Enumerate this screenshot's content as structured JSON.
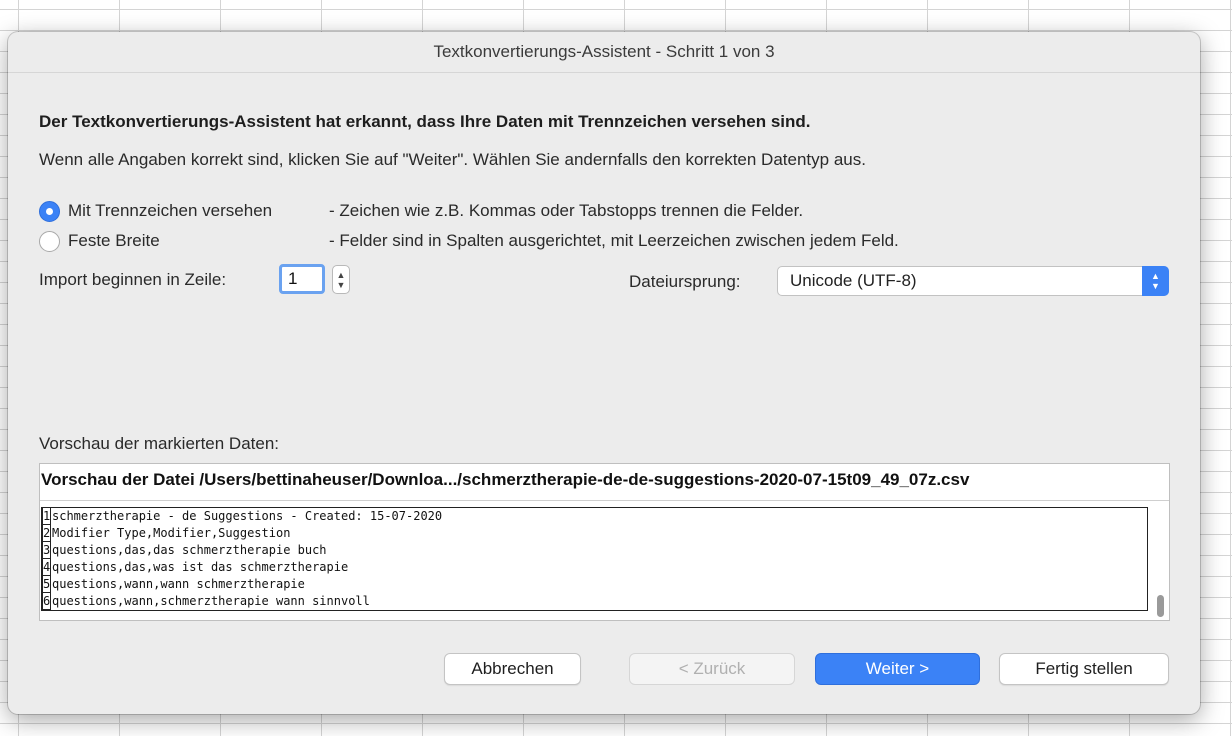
{
  "dialog": {
    "title": "Textkonvertierungs-Assistent - Schritt 1 von 3",
    "heading": "Der Textkonvertierungs-Assistent hat erkannt, dass Ihre Daten mit Trennzeichen versehen sind.",
    "description": "Wenn alle Angaben korrekt sind, klicken Sie auf \"Weiter\". Wählen Sie andernfalls den korrekten Datentyp aus."
  },
  "options": [
    {
      "label": "Mit Trennzeichen versehen",
      "description": "- Zeichen wie z.B. Kommas oder Tabstopps trennen die Felder.",
      "selected": true
    },
    {
      "label": "Feste Breite",
      "description": "- Felder sind in Spalten ausgerichtet, mit Leerzeichen zwischen jedem Feld.",
      "selected": false
    }
  ],
  "import_start": {
    "label": "Import beginnen in Zeile:",
    "value": "1"
  },
  "file_origin": {
    "label": "Dateiursprung:",
    "value": "Unicode (UTF-8)"
  },
  "preview": {
    "label": "Vorschau der markierten Daten:",
    "title": "Vorschau der Datei /Users/bettinaheuser/Downloa.../schmerztherapie-de-de-suggestions-2020-07-15t09_49_07z.csv",
    "lines": [
      {
        "num": "1",
        "text": "schmerztherapie - de Suggestions - Created: 15-07-2020"
      },
      {
        "num": "2",
        "text": "Modifier Type,Modifier,Suggestion"
      },
      {
        "num": "3",
        "text": "questions,das,das schmerztherapie buch"
      },
      {
        "num": "4",
        "text": "questions,das,was ist das schmerztherapie"
      },
      {
        "num": "5",
        "text": "questions,wann,wann schmerztherapie"
      },
      {
        "num": "6",
        "text": "questions,wann,schmerztherapie wann sinnvoll"
      }
    ]
  },
  "buttons": {
    "cancel": "Abbrechen",
    "back": "< Zurück",
    "next": "Weiter >",
    "finish": "Fertig stellen"
  },
  "colors": {
    "accent": "#3b82f6",
    "dialog_bg": "#ececec"
  }
}
